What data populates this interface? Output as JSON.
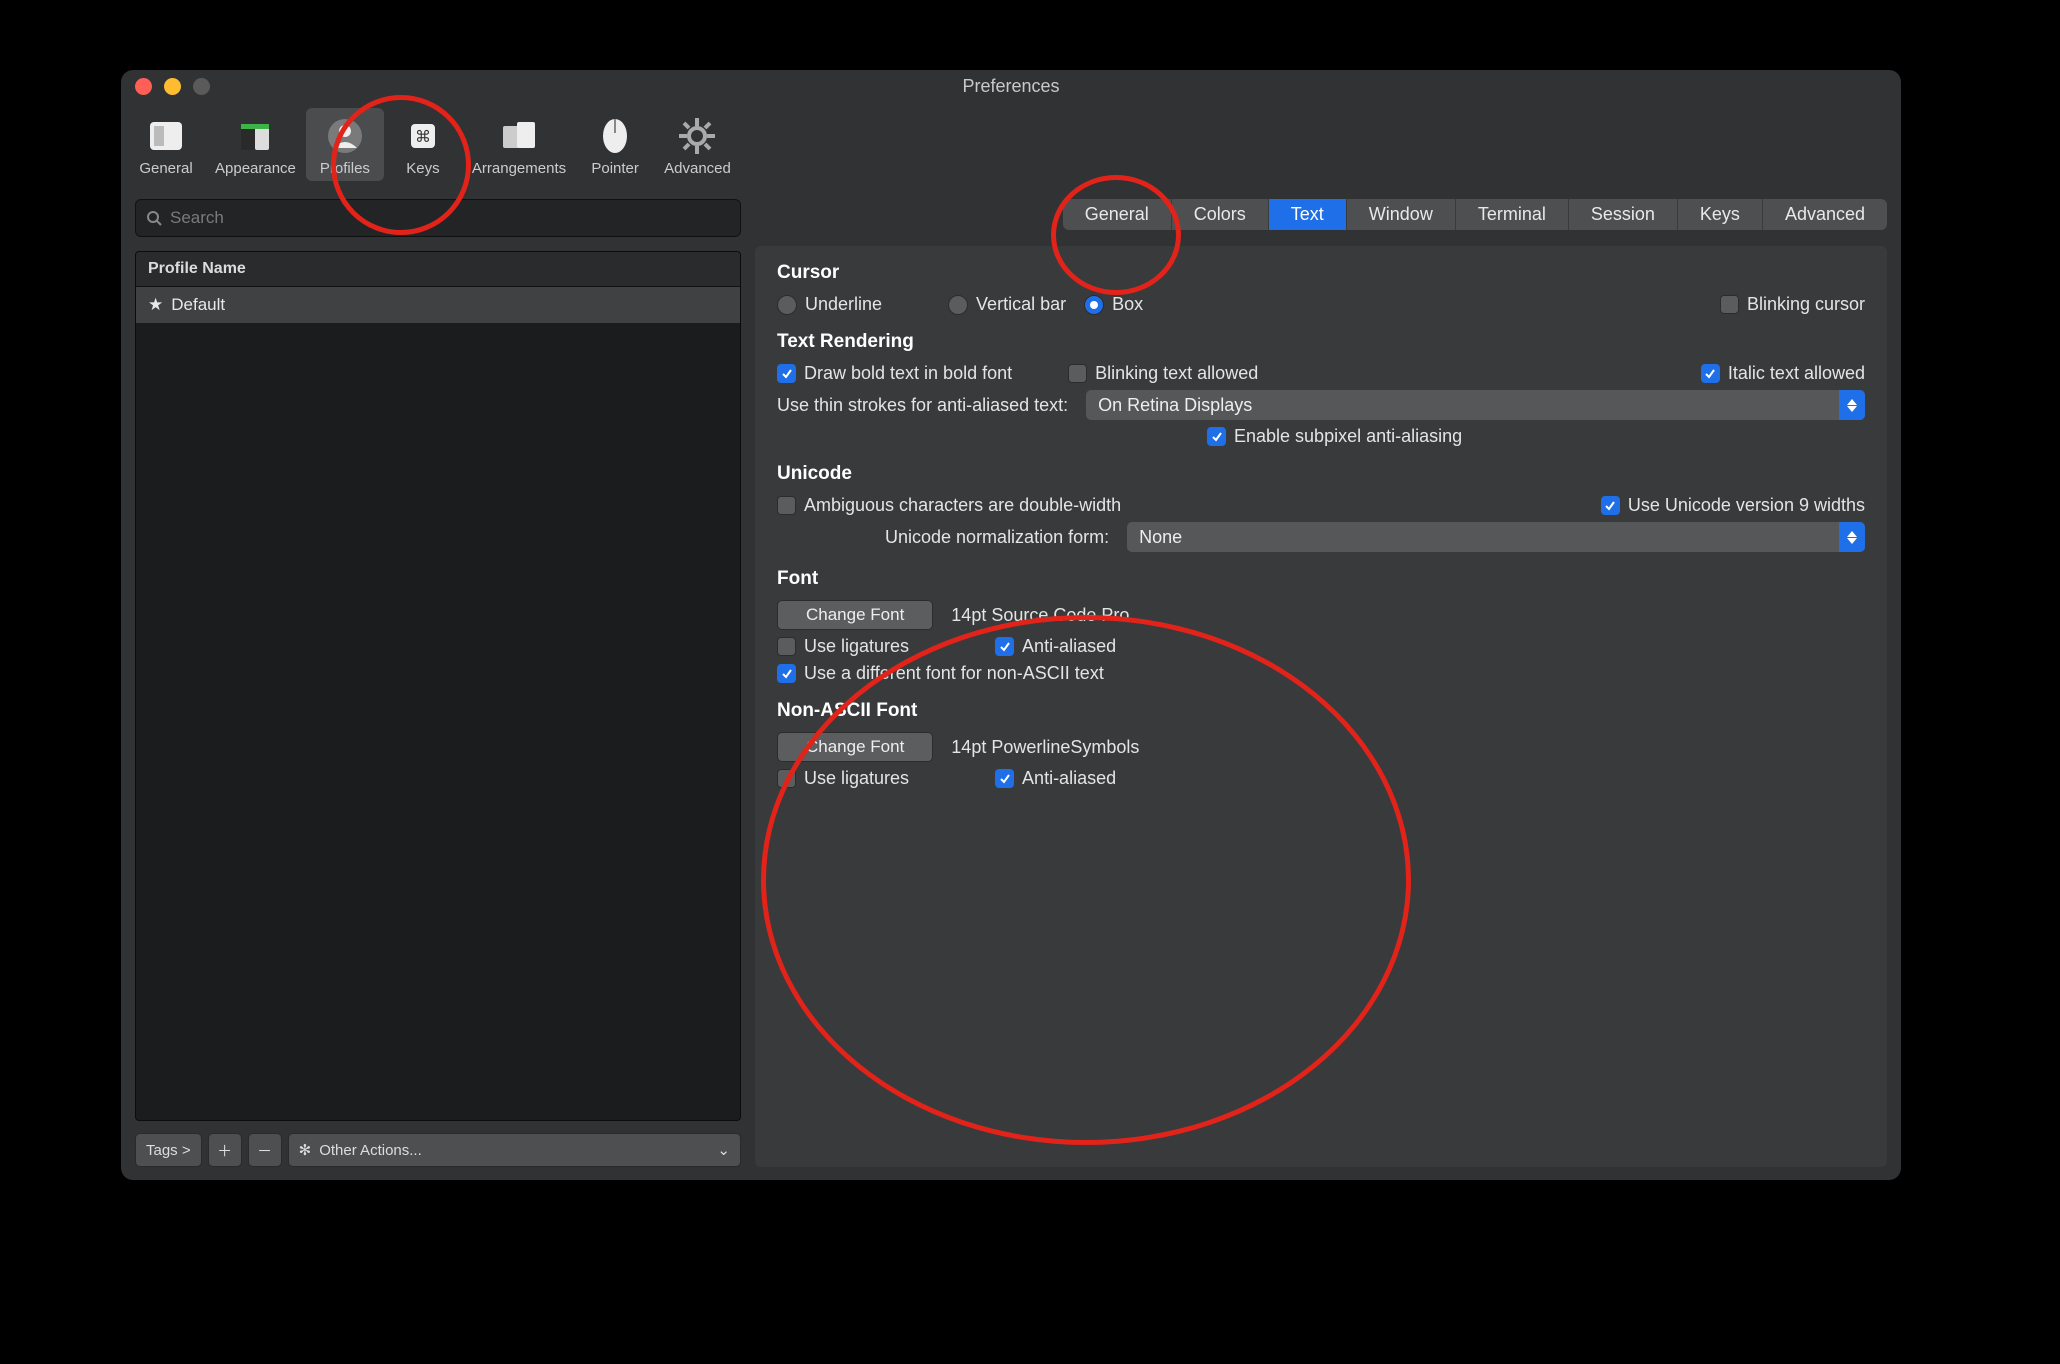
{
  "window": {
    "title": "Preferences"
  },
  "toolbar": {
    "items": [
      {
        "label": "General"
      },
      {
        "label": "Appearance"
      },
      {
        "label": "Profiles"
      },
      {
        "label": "Keys"
      },
      {
        "label": "Arrangements"
      },
      {
        "label": "Pointer"
      },
      {
        "label": "Advanced"
      }
    ],
    "selected_index": 2
  },
  "sidebar": {
    "search_placeholder": "Search",
    "header": "Profile Name",
    "profiles": [
      {
        "name": "Default",
        "starred": true
      }
    ],
    "bottom": {
      "tags": "Tags >",
      "other_actions": "Other Actions..."
    }
  },
  "tabs": {
    "items": [
      "General",
      "Colors",
      "Text",
      "Window",
      "Terminal",
      "Session",
      "Keys",
      "Advanced"
    ],
    "active_index": 2
  },
  "text_panel": {
    "cursor": {
      "heading": "Cursor",
      "shape_options": [
        "Underline",
        "Vertical bar",
        "Box"
      ],
      "shape_selected": 2,
      "blinking_label": "Blinking cursor",
      "blinking": false
    },
    "rendering": {
      "heading": "Text Rendering",
      "bold_label": "Draw bold text in bold font",
      "bold": true,
      "blinking_text_label": "Blinking text allowed",
      "blinking_text": false,
      "italic_label": "Italic text allowed",
      "italic": true,
      "thin_strokes_label": "Use thin strokes for anti-aliased text:",
      "thin_strokes_value": "On Retina Displays",
      "subpixel_label": "Enable subpixel anti-aliasing",
      "subpixel": true
    },
    "unicode": {
      "heading": "Unicode",
      "ambiguous_label": "Ambiguous characters are double-width",
      "ambiguous": false,
      "v9_label": "Use Unicode version 9 widths",
      "v9": true,
      "norm_label": "Unicode normalization form:",
      "norm_value": "None"
    },
    "font": {
      "heading": "Font",
      "change_btn": "Change Font",
      "current": "14pt Source Code Pro",
      "ligatures_label": "Use ligatures",
      "ligatures": false,
      "aa_label": "Anti-aliased",
      "aa": true,
      "diff_label": "Use a different font for non-ASCII text",
      "diff": true
    },
    "non_ascii": {
      "heading": "Non-ASCII Font",
      "change_btn": "Change Font",
      "current": "14pt PowerlineSymbols",
      "ligatures_label": "Use ligatures",
      "ligatures": false,
      "aa_label": "Anti-aliased",
      "aa": true
    }
  }
}
